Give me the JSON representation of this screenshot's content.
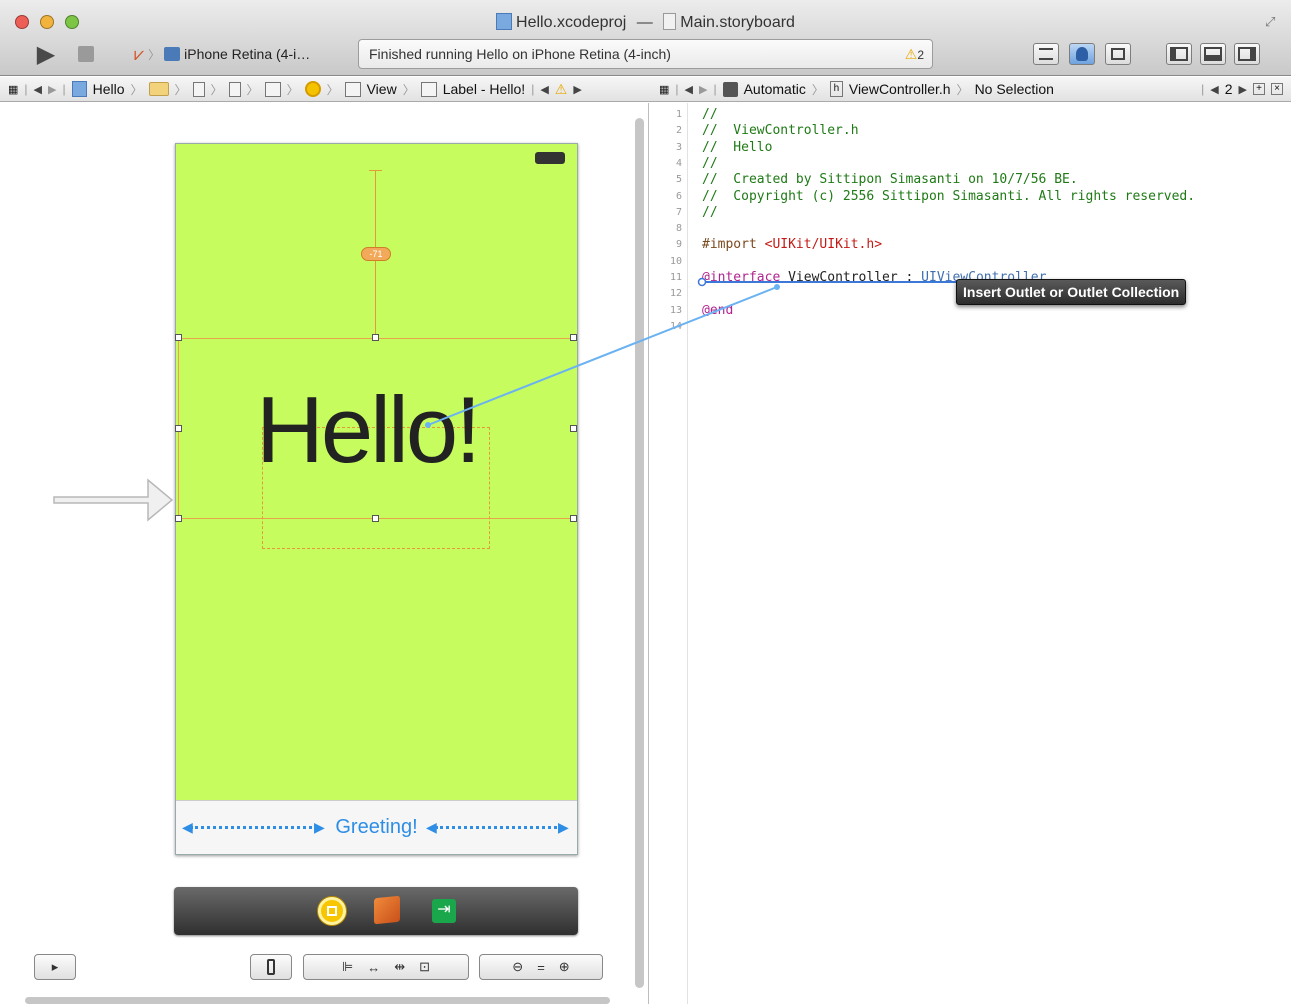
{
  "window": {
    "title_project": "Hello.xcodeproj",
    "title_sep": "—",
    "title_file": "Main.storyboard"
  },
  "toolbar": {
    "scheme_device": "iPhone Retina (4-i…",
    "activity_status": "Finished running Hello on iPhone Retina (4-inch)",
    "warning_count": "2"
  },
  "left_jumpbar": {
    "items": [
      "Hello",
      "View",
      "Label - Hello!"
    ]
  },
  "right_jumpbar": {
    "mode": "Automatic",
    "file": "ViewController.h",
    "selection": "No Selection",
    "counter": "2"
  },
  "canvas": {
    "label_text": "Hello!",
    "constraint_badge": "-71",
    "tab_item": "Greeting!"
  },
  "editor": {
    "lines": [
      {
        "n": "1",
        "t": "//"
      },
      {
        "n": "2",
        "t": "//  ViewController.h"
      },
      {
        "n": "3",
        "t": "//  Hello"
      },
      {
        "n": "4",
        "t": "//"
      },
      {
        "n": "5",
        "t": "//  Created by Sittipon Simasanti on 10/7/56 BE."
      },
      {
        "n": "6",
        "t": "//  Copyright (c) 2556 Sittipon Simasanti. All rights reserved."
      },
      {
        "n": "7",
        "t": "//"
      },
      {
        "n": "8",
        "t": ""
      },
      {
        "n": "9",
        "t": "#import <UIKit/UIKit.h>"
      },
      {
        "n": "10",
        "t": ""
      },
      {
        "n": "11",
        "t": "@interface ViewController : UIViewController"
      },
      {
        "n": "12",
        "t": ""
      },
      {
        "n": "13",
        "t": "@end"
      },
      {
        "n": "14",
        "t": ""
      }
    ],
    "import_kw": "#import",
    "import_path": "<UIKit/UIKit.h>",
    "interface_kw": "@interface",
    "interface_name": "ViewController",
    "interface_colon": ":",
    "interface_super": "UIViewController",
    "end_kw": "@end",
    "tooltip": "Insert Outlet or Outlet Collection"
  },
  "colors": {
    "scene_background": "#c6fc5e",
    "accent_blue": "#2e8ee6",
    "comment_green": "#1f7a16",
    "keyword_magenta": "#b0238f"
  }
}
